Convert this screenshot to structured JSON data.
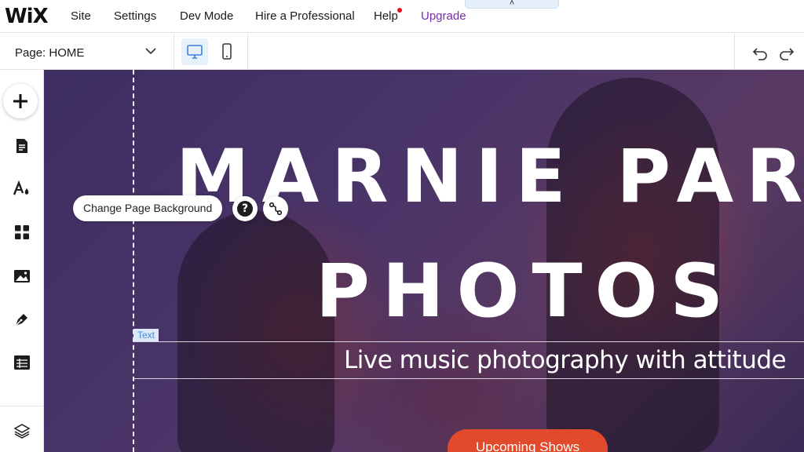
{
  "topbar": {
    "logo": "WiX",
    "menu": [
      "Site",
      "Settings",
      "Dev Mode",
      "Hire a Professional",
      "Help"
    ],
    "upgrade": "Upgrade",
    "collapse_glyph": "˄"
  },
  "pagebar": {
    "page_prefix": "Page:",
    "page_name": "HOME",
    "active_device": "desktop"
  },
  "sidebar": {
    "icons": [
      "add-icon",
      "pages-icon",
      "theme-icon",
      "apps-icon",
      "media-icon",
      "blog-icon",
      "table-icon",
      "layers-icon"
    ]
  },
  "canvas": {
    "title_line1": "MARNIE PAR",
    "title_line2": "PHOTOS",
    "text_tag": "Text",
    "subtitle": "Live music photography with attitude",
    "cta": "Upcoming Shows"
  },
  "overlay": {
    "background_chip": "Change Page Background",
    "help_glyph": "?"
  },
  "colors": {
    "accent_upgrade": "#7a2ca8",
    "cta_background": "#e24a2c",
    "notification_dot": "#e0131f",
    "selection_tag": "#dbe9f9"
  }
}
